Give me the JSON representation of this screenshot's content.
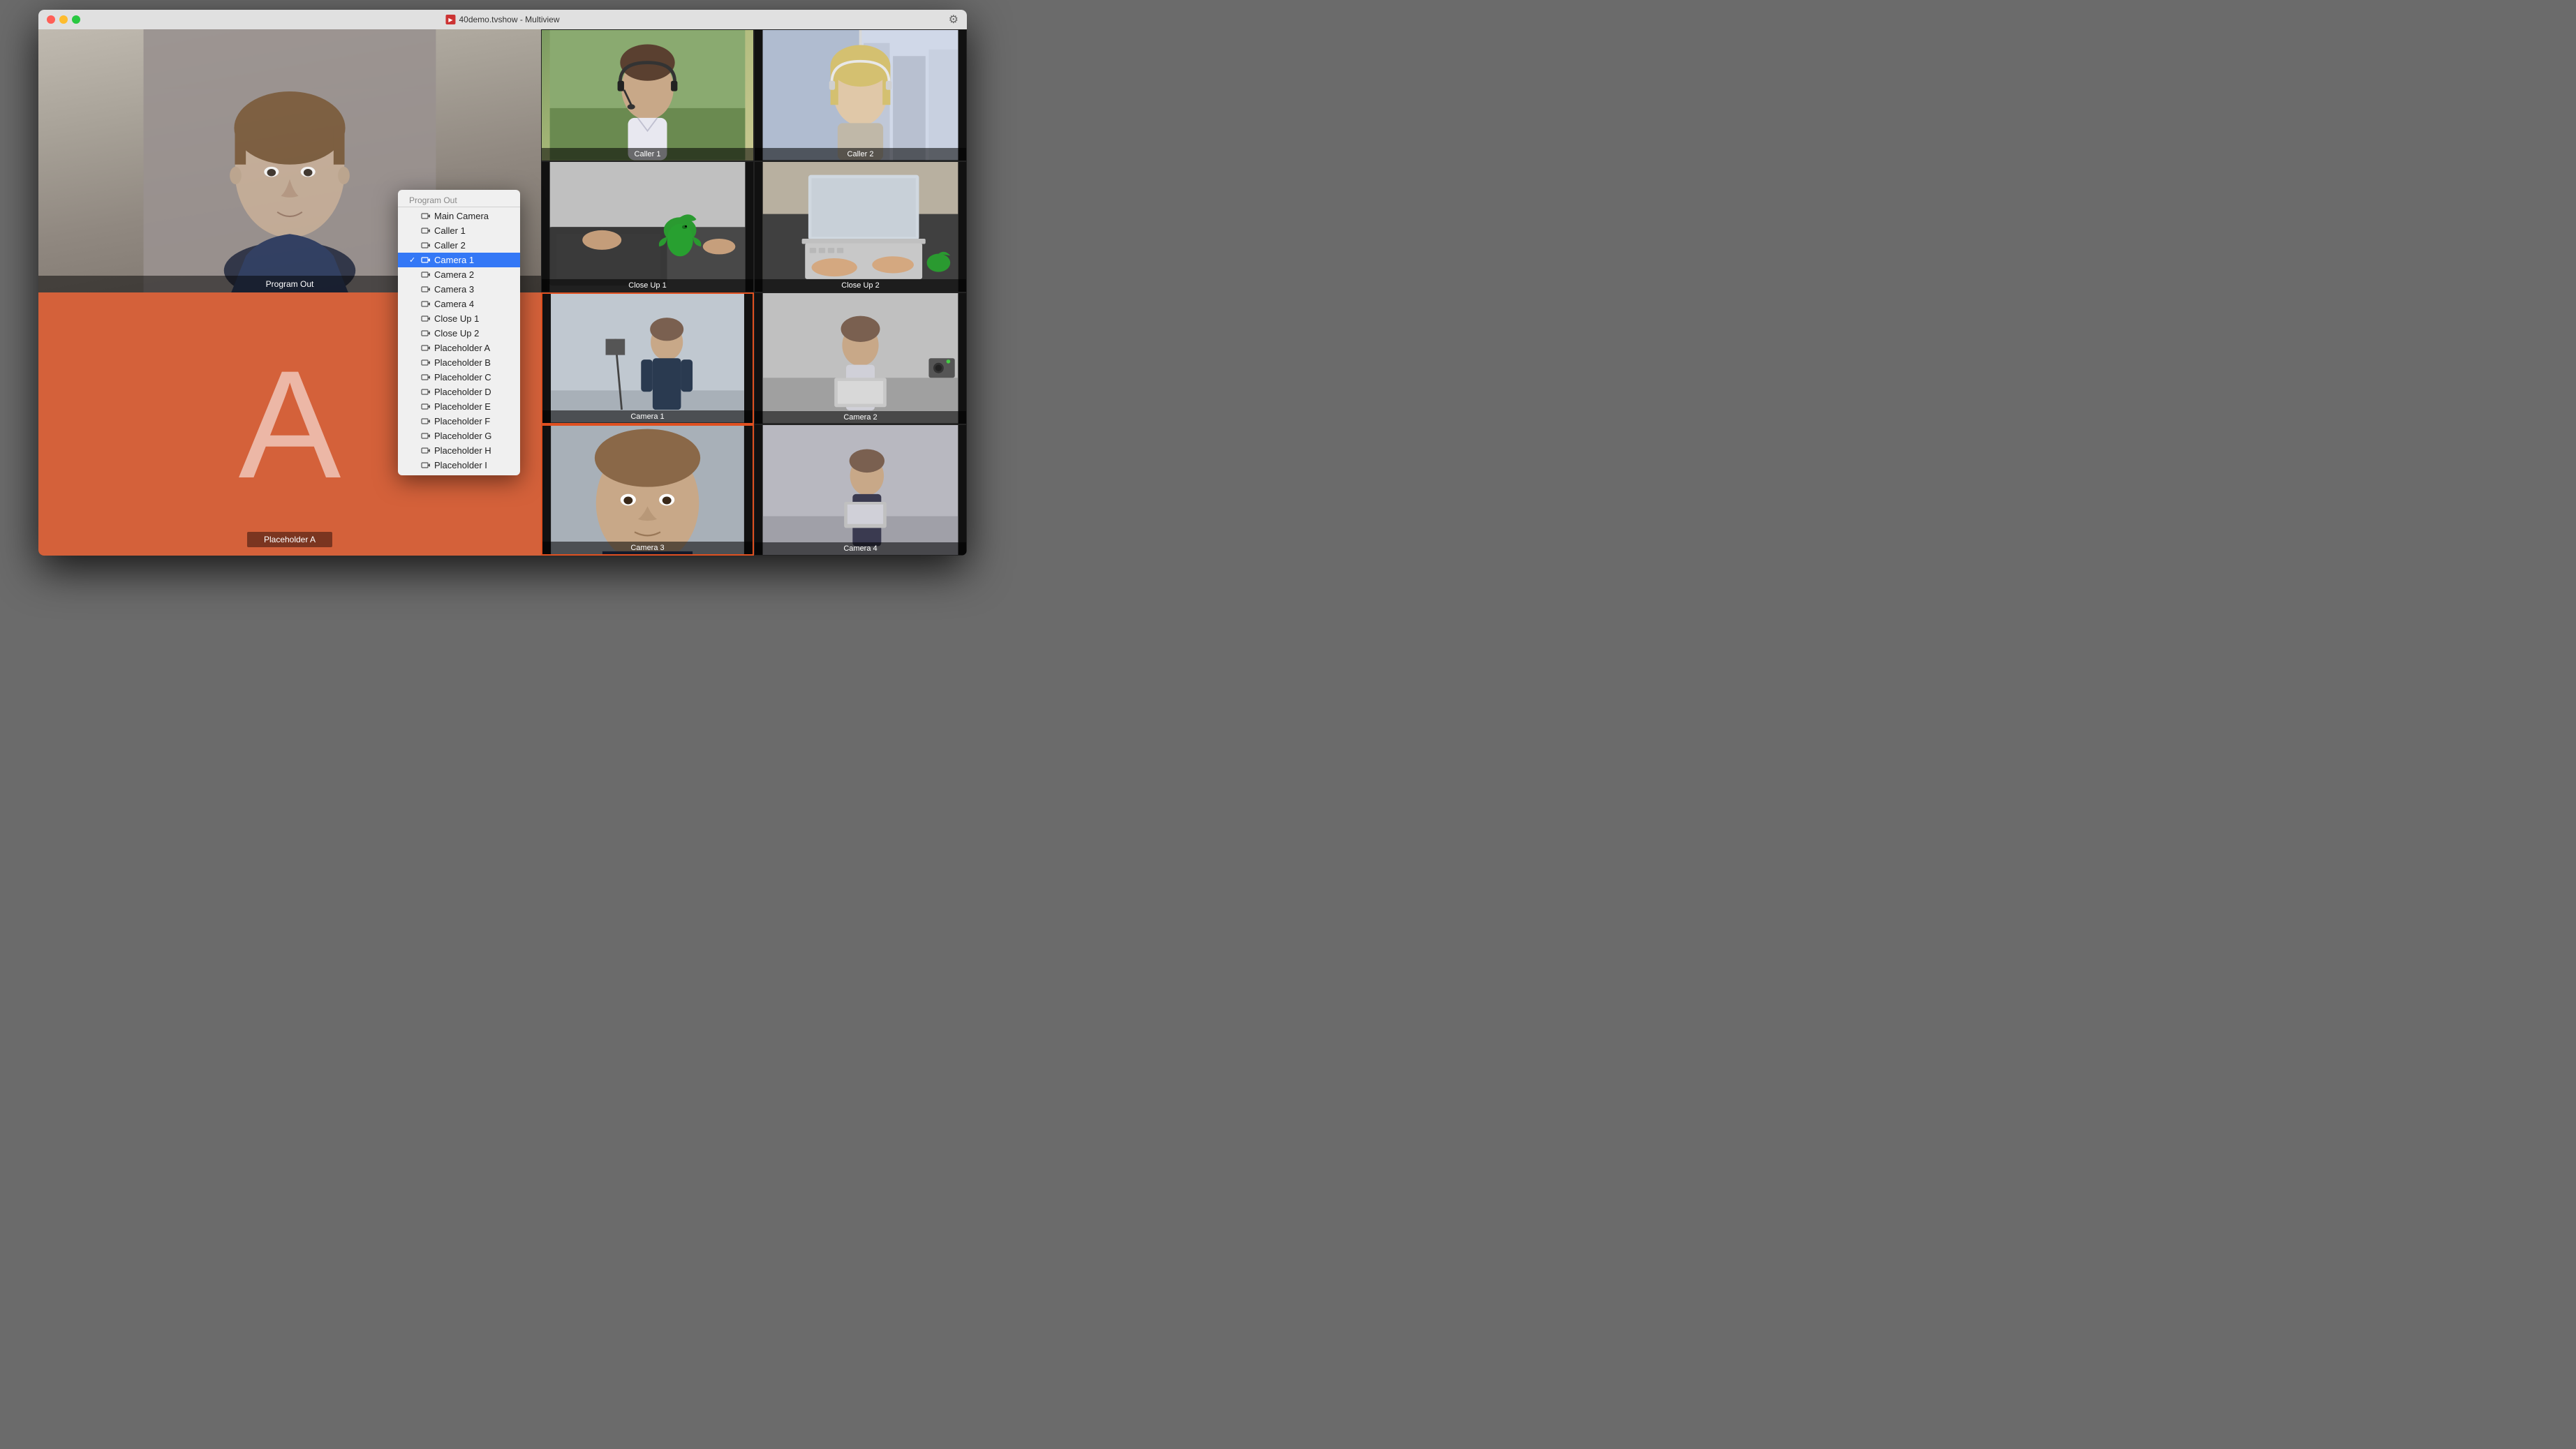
{
  "window": {
    "title": "40demo.tvshow - Multiview",
    "title_icon": "TV",
    "traffic_lights": [
      "red",
      "yellow",
      "green"
    ]
  },
  "views": {
    "program_out": {
      "label": "Program Out",
      "bg_color": "#9a9288"
    },
    "placeholder_a": {
      "label": "Placeholder A",
      "letter": "A",
      "bg_color": "#d4613a",
      "label_bg": "#7a3520"
    },
    "grid": [
      {
        "id": "caller1",
        "label": "Caller 1",
        "col": 1,
        "row": 1
      },
      {
        "id": "caller2",
        "label": "Caller 2",
        "col": 2,
        "row": 1
      },
      {
        "id": "closeup1",
        "label": "Close Up 1",
        "col": 1,
        "row": 2
      },
      {
        "id": "closeup2",
        "label": "Close Up 2",
        "col": 2,
        "row": 2
      },
      {
        "id": "camera1",
        "label": "Camera 1",
        "col": 1,
        "row": 3,
        "highlighted": true
      },
      {
        "id": "camera2",
        "label": "Camera 2",
        "col": 2,
        "row": 3
      },
      {
        "id": "camera3",
        "label": "Camera 3",
        "col": 1,
        "row": 4,
        "highlighted": true
      },
      {
        "id": "camera4",
        "label": "Camera 4",
        "col": 2,
        "row": 4
      }
    ]
  },
  "dropdown": {
    "header": "Program Out",
    "items": [
      {
        "id": "main-camera",
        "label": "Main Camera",
        "checked": false,
        "icon": true
      },
      {
        "id": "caller1",
        "label": "Caller 1",
        "checked": false,
        "icon": true
      },
      {
        "id": "caller2",
        "label": "Caller 2",
        "checked": false,
        "icon": true
      },
      {
        "id": "camera1",
        "label": "Camera 1",
        "checked": true,
        "icon": true,
        "selected": true
      },
      {
        "id": "camera2",
        "label": "Camera 2",
        "checked": false,
        "icon": true
      },
      {
        "id": "camera3",
        "label": "Camera 3",
        "checked": false,
        "icon": true
      },
      {
        "id": "camera4",
        "label": "Camera 4",
        "checked": false,
        "icon": true
      },
      {
        "id": "closeup1",
        "label": "Close Up 1",
        "checked": false,
        "icon": true
      },
      {
        "id": "closeup2",
        "label": "Close Up 2",
        "checked": false,
        "icon": true
      },
      {
        "id": "placeholder-a",
        "label": "Placeholder A",
        "checked": false,
        "icon": true
      },
      {
        "id": "placeholder-b",
        "label": "Placeholder B",
        "checked": false,
        "icon": true
      },
      {
        "id": "placeholder-c",
        "label": "Placeholder C",
        "checked": false,
        "icon": true
      },
      {
        "id": "placeholder-d",
        "label": "Placeholder D",
        "checked": false,
        "icon": true
      },
      {
        "id": "placeholder-e",
        "label": "Placeholder E",
        "checked": false,
        "icon": true
      },
      {
        "id": "placeholder-f",
        "label": "Placeholder F",
        "checked": false,
        "icon": true
      },
      {
        "id": "placeholder-g",
        "label": "Placeholder G",
        "checked": false,
        "icon": true
      },
      {
        "id": "placeholder-h",
        "label": "Placeholder H",
        "checked": false,
        "icon": true
      },
      {
        "id": "placeholder-i",
        "label": "Placeholder I",
        "checked": false,
        "icon": true
      }
    ]
  }
}
